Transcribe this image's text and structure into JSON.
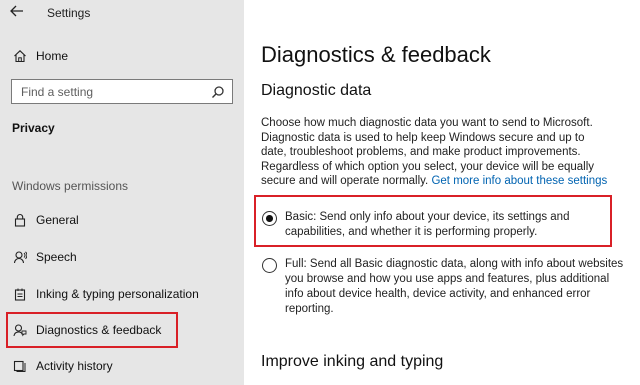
{
  "window": {
    "title": "Settings"
  },
  "sidebar": {
    "home_label": "Home",
    "search_placeholder": "Find a setting",
    "section_title": "Privacy",
    "group_title": "Windows permissions",
    "items": [
      {
        "label": "General",
        "icon": "lock-icon"
      },
      {
        "label": "Speech",
        "icon": "speech-icon"
      },
      {
        "label": "Inking & typing personalization",
        "icon": "inking-icon"
      },
      {
        "label": "Diagnostics & feedback",
        "icon": "diagnostics-icon",
        "selected": true
      },
      {
        "label": "Activity history",
        "icon": "activity-icon"
      }
    ]
  },
  "main": {
    "title": "Diagnostics & feedback",
    "section_title": "Diagnostic data",
    "description": "Choose how much diagnostic data you want to send to Microsoft. Diagnostic data is used to help keep Windows secure and up to date, troubleshoot problems, and make product improvements. Regardless of which option you select, your device will be equally secure and will operate normally.",
    "link_text": "Get more info about these settings",
    "options": [
      {
        "label": "Basic: Send only info about your device, its settings and capabilities, and whether it is performing properly.",
        "selected": true
      },
      {
        "label": "Full: Send all Basic diagnostic data, along with info about websites you browse and how you use apps and features, plus additional info about device health, device activity, and enhanced error reporting.",
        "selected": false
      }
    ],
    "next_section_title": "Improve inking and typing"
  },
  "colors": {
    "highlight": "#d92027",
    "link": "#0063b1",
    "sidebar_bg": "#e6e6e6"
  }
}
